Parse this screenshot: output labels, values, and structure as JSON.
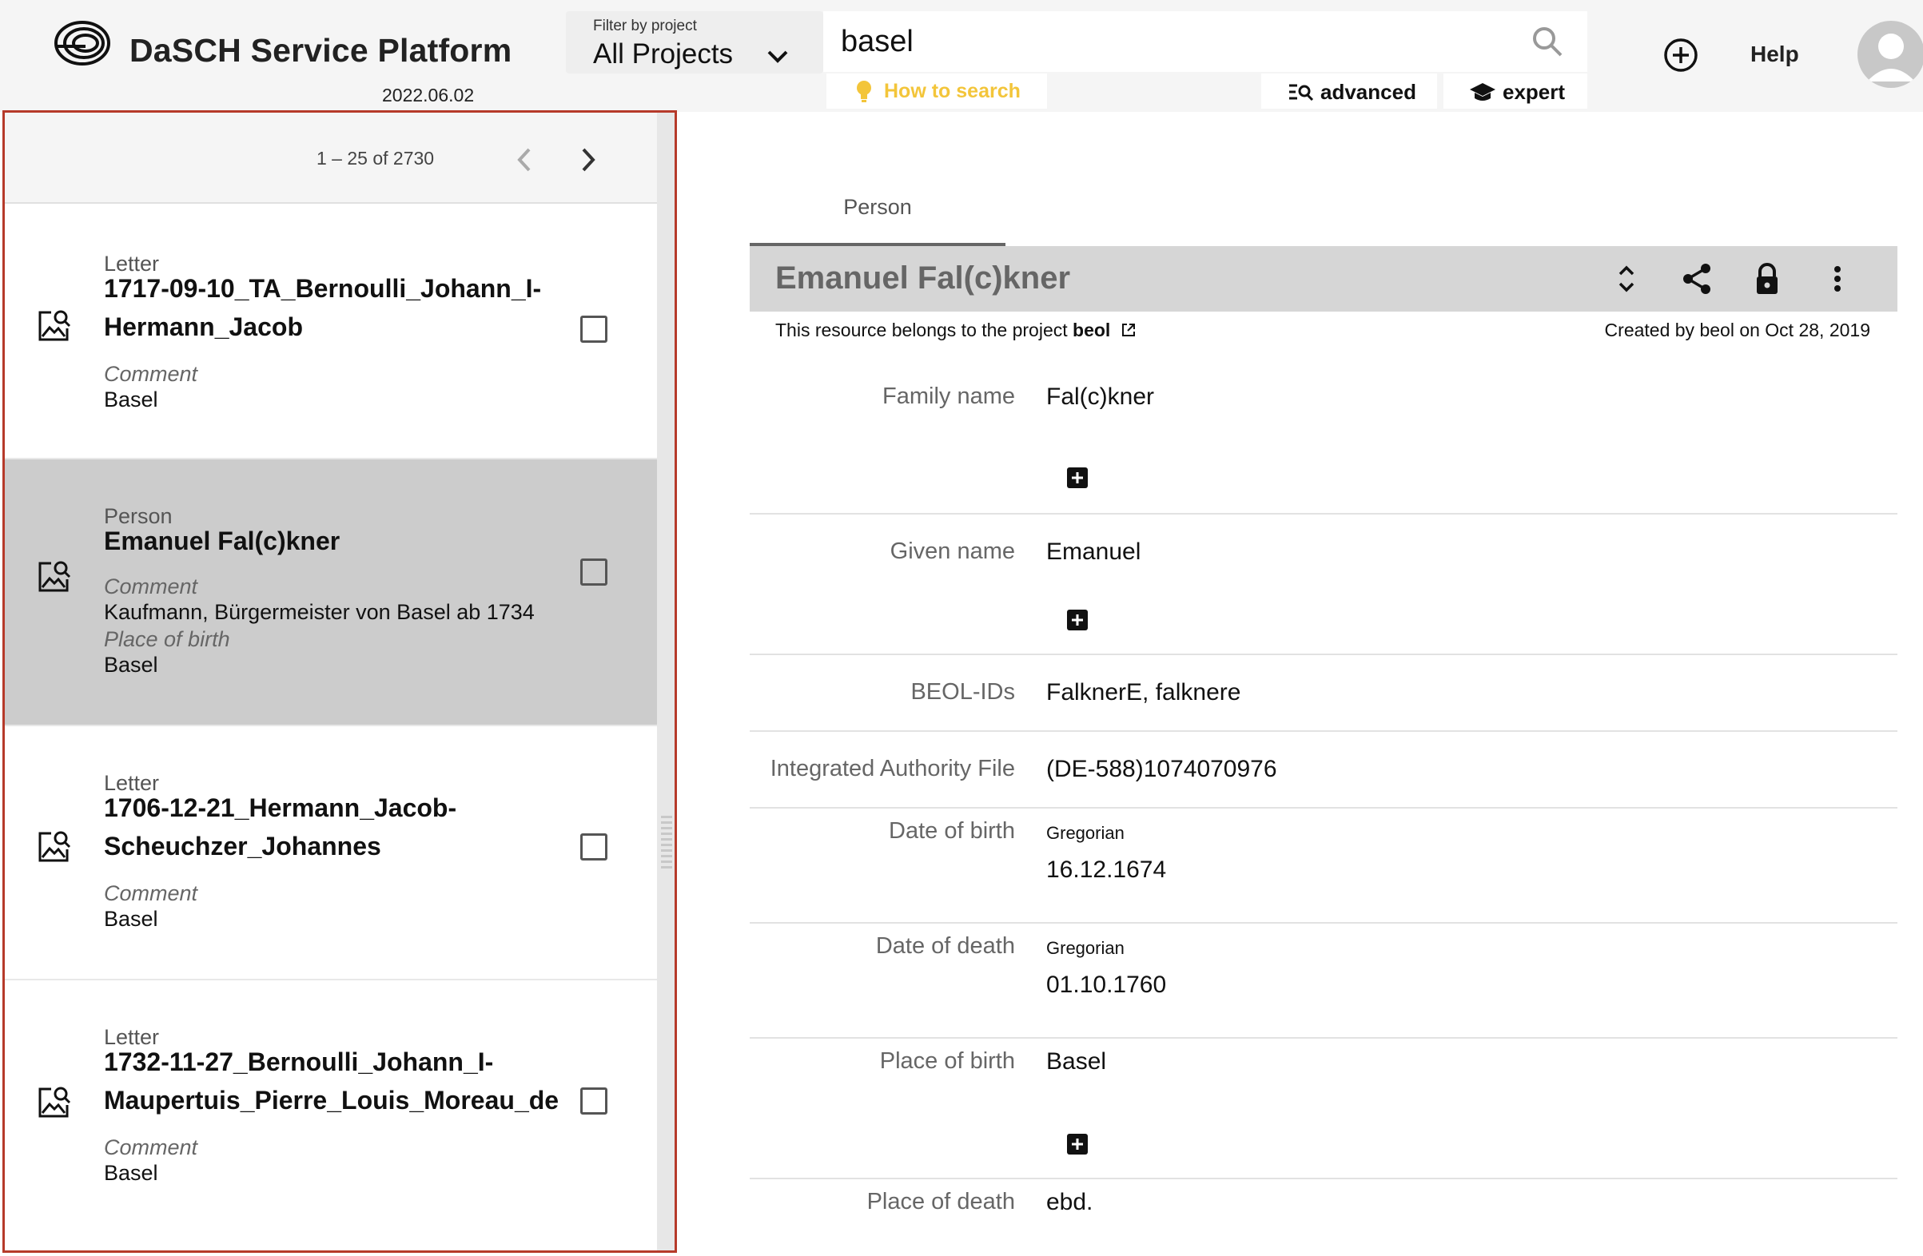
{
  "header": {
    "brand": "DaSCH Service Platform",
    "version": "2022.06.02",
    "filter": {
      "label": "Filter by project",
      "value": "All Projects"
    },
    "search": {
      "value": "basel",
      "placeholder": ""
    },
    "how_to_search": "How to search",
    "advanced": "advanced",
    "expert": "expert",
    "help": "Help"
  },
  "list": {
    "pager": "1 – 25 of 2730",
    "items": [
      {
        "type": "Letter",
        "title": "1717-09-10_TA_Bernoulli_Johann_I-Hermann_Jacob",
        "fields": [
          {
            "label": "Comment",
            "value": "Basel"
          }
        ]
      },
      {
        "type": "Person",
        "title": "Emanuel Fal(c)kner",
        "fields": [
          {
            "label": "Comment",
            "value": "Kaufmann, Bürgermeister von Basel ab 1734"
          },
          {
            "label": "Place of birth",
            "value": "Basel"
          }
        ]
      },
      {
        "type": "Letter",
        "title": "1706-12-21_Hermann_Jacob-Scheuchzer_Johannes",
        "fields": [
          {
            "label": "Comment",
            "value": "Basel"
          }
        ]
      },
      {
        "type": "Letter",
        "title": "1732-11-27_Bernoulli_Johann_I-Maupertuis_Pierre_Louis_Moreau_de",
        "fields": [
          {
            "label": "Comment",
            "value": "Basel"
          }
        ]
      }
    ]
  },
  "resource": {
    "tab": "Person",
    "title": "Emanuel Fal(c)kner",
    "project_prefix": "This resource belongs to the project",
    "project_name": "beol",
    "created": "Created by beol on Oct 28, 2019",
    "properties": {
      "family_name": {
        "label": "Family name",
        "value": "Fal(c)kner"
      },
      "given_name": {
        "label": "Given name",
        "value": "Emanuel"
      },
      "beol_ids": {
        "label": "BEOL-IDs",
        "value": "FalknerE, falknere"
      },
      "iaf": {
        "label": "Integrated Authority File",
        "value": "(DE-588)1074070976"
      },
      "date_of_birth": {
        "label": "Date of birth",
        "calendar": "Gregorian",
        "value": "16.12.1674"
      },
      "date_of_death": {
        "label": "Date of death",
        "calendar": "Gregorian",
        "value": "01.10.1760"
      },
      "place_of_birth": {
        "label": "Place of birth",
        "value": "Basel"
      },
      "place_of_death": {
        "label": "Place of death",
        "value": "ebd."
      }
    }
  }
}
